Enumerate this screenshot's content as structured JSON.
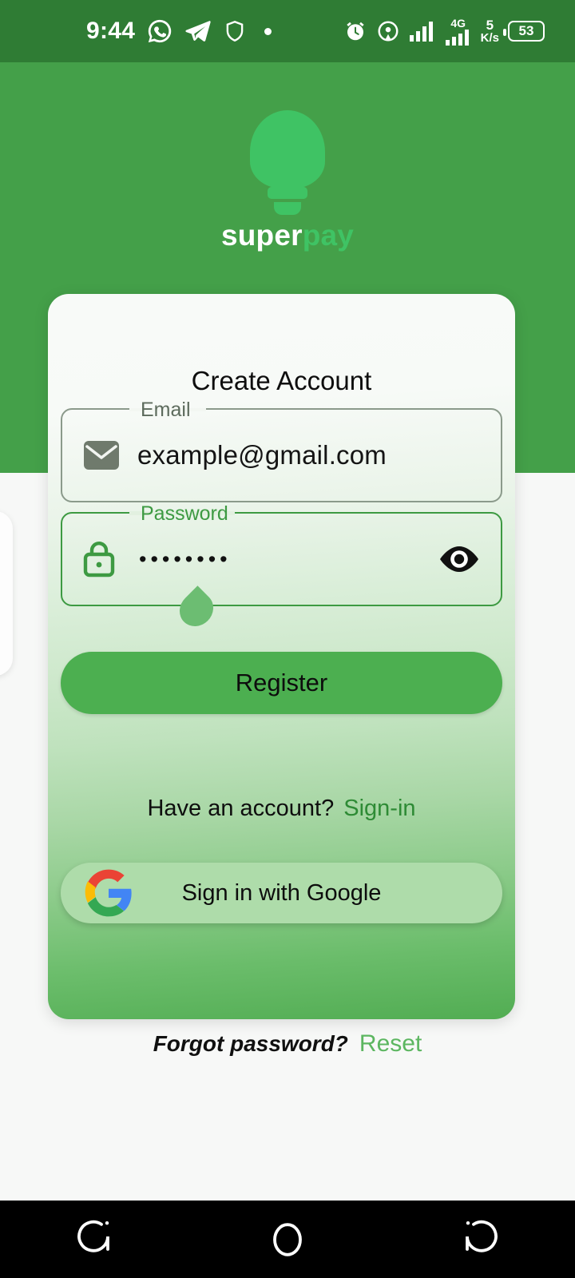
{
  "statusbar": {
    "time": "9:44",
    "left_icons": [
      "whatsapp-icon",
      "telegram-icon",
      "shield-icon",
      "dot-indicator"
    ],
    "network_type": "4G",
    "network_speed_value": "5",
    "network_speed_unit": "K/s",
    "battery_level": "53",
    "right_icons": [
      "alarm-icon",
      "cast-icon",
      "signal-icon"
    ],
    "background_color": "#2f7c34"
  },
  "brand": {
    "logo_icon": "lightbulb-icon",
    "name_part1": "super",
    "name_part2": "pay",
    "header_color": "#44a049",
    "accent_color": "#3fc364"
  },
  "card": {
    "title": "Create Account",
    "email_field": {
      "label": "Email",
      "value": "example@gmail.com",
      "icon": "envelope-icon",
      "focused": false
    },
    "password_field": {
      "label": "Password",
      "value": "••••••••",
      "icon": "lock-icon",
      "toggle_icon": "eye-icon",
      "focused": true
    },
    "register_button": "Register",
    "have_account_text": "Have an account?",
    "sign_in_link": "Sign-in",
    "google_button": {
      "label": "Sign in with Google",
      "icon": "google-g-icon"
    }
  },
  "footer": {
    "forgot_text": "Forgot password?",
    "reset_link": "Reset"
  },
  "navbar": {
    "recents_label": "recent-apps",
    "home_label": "home",
    "back_label": "back"
  }
}
